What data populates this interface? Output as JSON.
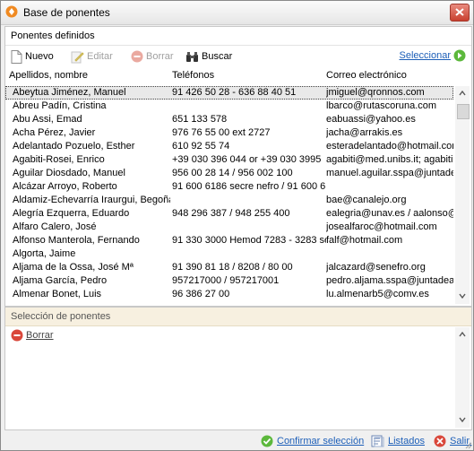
{
  "window": {
    "title": "Base de ponentes"
  },
  "panel": {
    "title": "Ponentes definidos"
  },
  "toolbar": {
    "nuevo": "Nuevo",
    "editar": "Editar",
    "borrar": "Borrar",
    "buscar": "Buscar",
    "seleccionar": "Seleccionar"
  },
  "columns": {
    "name": "Apellidos, nombre",
    "phone": "Teléfonos",
    "email": "Correo electrónico"
  },
  "rows": [
    {
      "name": "Abeytua Jiménez, Manuel",
      "phone": "91 426 50 28 - 636 88 40 51",
      "email": "jmiguel@qronnos.com"
    },
    {
      "name": "Abreu Padín, Cristina",
      "phone": "",
      "email": "lbarco@rutascoruna.com"
    },
    {
      "name": "Abu Assi, Emad",
      "phone": "651 133 578",
      "email": "eabuassi@yahoo.es"
    },
    {
      "name": "Acha Pérez, Javier",
      "phone": "976 76 55 00 ext 2727",
      "email": "jacha@arrakis.es"
    },
    {
      "name": "Adelantado Pozuelo, Esther",
      "phone": "610 92 55 74",
      "email": "esteradelantado@hotmail.com"
    },
    {
      "name": "Agabiti-Rosei, Enrico",
      "phone": "+39 030 396 044 or +39 030 3995",
      "email": "agabiti@med.unibs.it; agabiti"
    },
    {
      "name": "Aguilar Diosdado, Manuel",
      "phone": "956 00 28 14 / 956 002 100",
      "email": "manuel.aguilar.sspa@juntade"
    },
    {
      "name": "Alcázar Arroyo, Roberto",
      "phone": "91 600 6186 secre nefro / 91 600 6",
      "email": ""
    },
    {
      "name": "Aldamiz-Echevarría Iraurgui, Begoña",
      "phone": "",
      "email": "bae@canalejo.org"
    },
    {
      "name": "Alegría Ezquerra, Eduardo",
      "phone": "948 296 387 / 948 255 400",
      "email": "ealegria@unav.es / aalonso@"
    },
    {
      "name": "Alfaro Calero, José",
      "phone": "",
      "email": "josealfaroc@hotmail.com"
    },
    {
      "name": "Alfonso Manterola, Fernando",
      "phone": "91 330 3000 Hemod 7283 - 3283 se",
      "email": "falf@hotmail.com"
    },
    {
      "name": "Algorta, Jaime",
      "phone": "",
      "email": ""
    },
    {
      "name": "Aljama de la Ossa, José Mª",
      "phone": "91 390 81 18 / 8208 / 80 00",
      "email": "jalcazard@senefro.org"
    },
    {
      "name": "Aljama García, Pedro",
      "phone": "957217000 / 957217001",
      "email": "pedro.aljama.sspa@juntadea"
    },
    {
      "name": "Almenar Bonet, Luis",
      "phone": "96 386 27 00",
      "email": "lu.almenarb5@comv.es"
    }
  ],
  "selection": {
    "title": "Selección de ponentes",
    "borrar": "Borrar"
  },
  "footer": {
    "confirmar": "Confirmar selección",
    "listados": "Listados",
    "salir": "Salir."
  },
  "colors": {
    "accent_link": "#1d5fb8",
    "close_button": "#c9402f",
    "selection_header": "#f7f0e0"
  }
}
